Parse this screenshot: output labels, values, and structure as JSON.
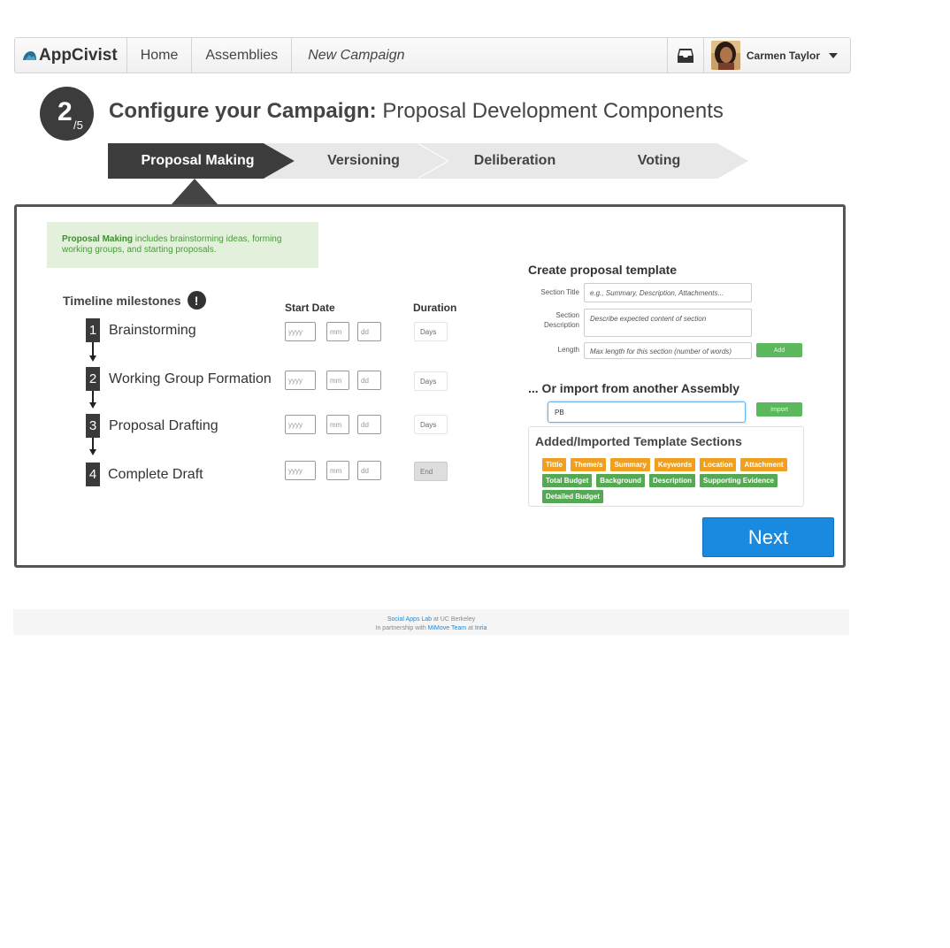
{
  "nav": {
    "brand": "AppCivist",
    "items": [
      {
        "label": "Home"
      },
      {
        "label": "Assemblies"
      },
      {
        "label": "New Campaign"
      }
    ],
    "user_name": "Carmen Taylor"
  },
  "step": {
    "current": "2",
    "total": "/5",
    "title_bold": "Configure your Campaign:",
    "title_rest": "Proposal Development Components"
  },
  "phases": [
    {
      "label": "Proposal Making",
      "active": true
    },
    {
      "label": "Versioning",
      "active": false
    },
    {
      "label": "Deliberation",
      "active": false
    },
    {
      "label": "Voting",
      "active": false
    }
  ],
  "info": {
    "bold": "Proposal Making",
    "text": " includes brainstorming ideas, forming working groups, and starting proposals."
  },
  "timeline": {
    "title": "Timeline milestones",
    "warn_glyph": "!",
    "start_date_header": "Start Date",
    "duration_header": "Duration",
    "placeholders": {
      "year": "yyyy",
      "month": "mm",
      "day": "dd"
    },
    "milestones": [
      {
        "num": "1",
        "label": "Brainstorming",
        "duration": "Days"
      },
      {
        "num": "2",
        "label": "Working Group Formation",
        "duration": "Days"
      },
      {
        "num": "3",
        "label": "Proposal Drafting",
        "duration": "Days"
      },
      {
        "num": "4",
        "label": "Complete Draft",
        "duration": "End"
      }
    ]
  },
  "template": {
    "title": "Create proposal template",
    "section_title_label": "Section Title",
    "section_title_placeholder": "e.g., Summary, Description, Attachments...",
    "section_desc_label_1": "Section",
    "section_desc_label_2": "Description",
    "section_desc_placeholder": "Describe expected content of section",
    "length_label": "Length",
    "length_placeholder": "Max length for this section (number of words)",
    "add_label": "Add"
  },
  "import": {
    "title": "... Or import from another Assembly",
    "value": "PB",
    "button": "Import"
  },
  "sections": {
    "title": "Added/Imported Template Sections",
    "tags": [
      {
        "label": "Tittle",
        "color": "orange"
      },
      {
        "label": "Theme/s",
        "color": "orange"
      },
      {
        "label": "Summary",
        "color": "orange"
      },
      {
        "label": "Keywords",
        "color": "orange"
      },
      {
        "label": "Location",
        "color": "orange"
      },
      {
        "label": "Attachment",
        "color": "orange"
      },
      {
        "label": "Total Budget",
        "color": "green"
      },
      {
        "label": "Background",
        "color": "green"
      },
      {
        "label": "Description",
        "color": "green"
      },
      {
        "label": "Supporting Evidence",
        "color": "green"
      },
      {
        "label": "Detailed Budget",
        "color": "green"
      }
    ]
  },
  "next_label": "Next",
  "footer": {
    "lab": "Social Apps Lab",
    "lab_suffix": " at UC Berkeley",
    "partner_prefix": "In partnership with ",
    "team": "MiMove Team",
    "at": " at ",
    "inst": "Inria"
  },
  "colors": {
    "accent_blue": "#1a8ae0",
    "green": "#5cb85c",
    "orange": "#f0a020",
    "dark": "#3c3c3c"
  }
}
